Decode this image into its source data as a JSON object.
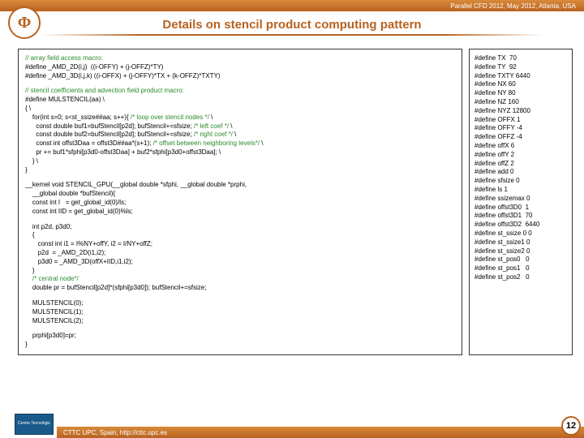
{
  "header": {
    "conference": "Parallel CFD 2012, May 2012, Atlanta, USA"
  },
  "title": "Details on stencil product computing pattern",
  "logo": "Φ",
  "code_comments": {
    "c1": "// array field access macro:",
    "c2": "// stencil coefficients and advection field product macro:",
    "c3": "/* loop over stencil nodes */",
    "c4": "/* left coef */",
    "c5": "/* right coef */",
    "c6": "/* offset between neighboring levels*/",
    "c7": "/* central node*/"
  },
  "code_lines": {
    "l1": "#define _AMD_2D(i,j)  ((i-OFFY) + (j-OFFZ)*TY)",
    "l2": "#define _AMD_3D(i,j,k) ((i-OFFX) + (j-OFFY)*TX + (k-OFFZ)*TXTY)",
    "l3": "#define MULSTENCIL(aa) \\",
    "l4": "{ \\",
    "l5": "    for(int s=0; s<st_ssize##aa; s++){ ",
    "l5b": " \\",
    "l6": "      const double buf1=bufStencil[p2d]; bufStencil+=sfsize; ",
    "l6b": " \\",
    "l7": "      const double buf2=bufStencil[p2d]; bufStencil+=sfsize; ",
    "l7b": " \\",
    "l8": "      const int offst3Daa = offst3D##aa*(s+1); ",
    "l8b": " \\",
    "l9": "      pr += buf1*sfphi[p3d0-offst3Daa] + buf2*sfphi[p3d0+offst3Daa]; \\",
    "l10": "    } \\",
    "l11": "}",
    "k1": "__kernel void STENCIL_GPU(__global double *sfphi, __global double *prphi,",
    "k2": "    __global double *bufStencil){",
    "k3": "    const int I   = get_global_id(0)/ls;",
    "k4": "    const int IID = get_global_id(0)%ls;",
    "k5": "    int p2d, p3d0;",
    "k6": "    {",
    "k7": "       const int i1 = I%NY+offY, i2 = I/NY+offZ;",
    "k8": "       p2d  = _AMD_2D(i1,i2);",
    "k9": "       p3d0 = _AMD_3D(offX+IID,i1,i2);",
    "k10": "    }",
    "k12": "    double pr = bufStencil[p2d]*(sfphi[p3d0]); bufStencil+=sfsize;",
    "m1": "    MULSTENCIL(0);",
    "m2": "    MULSTENCIL(1);",
    "m3": "    MULSTENCIL(2);",
    "p1": "    prphi[p3d0]=pr;",
    "p2": "}"
  },
  "defines": {
    "d1": "#define TX  70",
    "d2": "#define TY  92",
    "d3": "#define TXTY 6440",
    "d4": "#define NX 60",
    "d5": "#define NY 80",
    "d6": "#define NZ 160",
    "d7": "#define NYZ 12800",
    "d8": "#define OFFX 1",
    "d9": "#define OFFY -4",
    "d10": "#define OFFZ -4",
    "d11": "#define offX 6",
    "d12": "#define offY 2",
    "d13": "#define offZ 2",
    "d14": "#define add 0",
    "d15": "#define sfsize 0",
    "d16": "#define ls 1",
    "d17": "#define ssizemax 0",
    "d18": "#define offst3D0  1",
    "d19": "#define offst3D1  70",
    "d20": "#define offst3D2  6440",
    "d21": "#define st_ssize 0 0",
    "d22": "#define st_ssize1 0",
    "d23": "#define st_ssize2 0",
    "d24": "#define st_pos0   0",
    "d25": "#define st_pos1   0",
    "d26": "#define st_pos2   0"
  },
  "footer": {
    "org": "CTTC UPC, Spain, http://cttc.upc.es",
    "logo_text": "Centre Tecnològic",
    "page": "12"
  }
}
